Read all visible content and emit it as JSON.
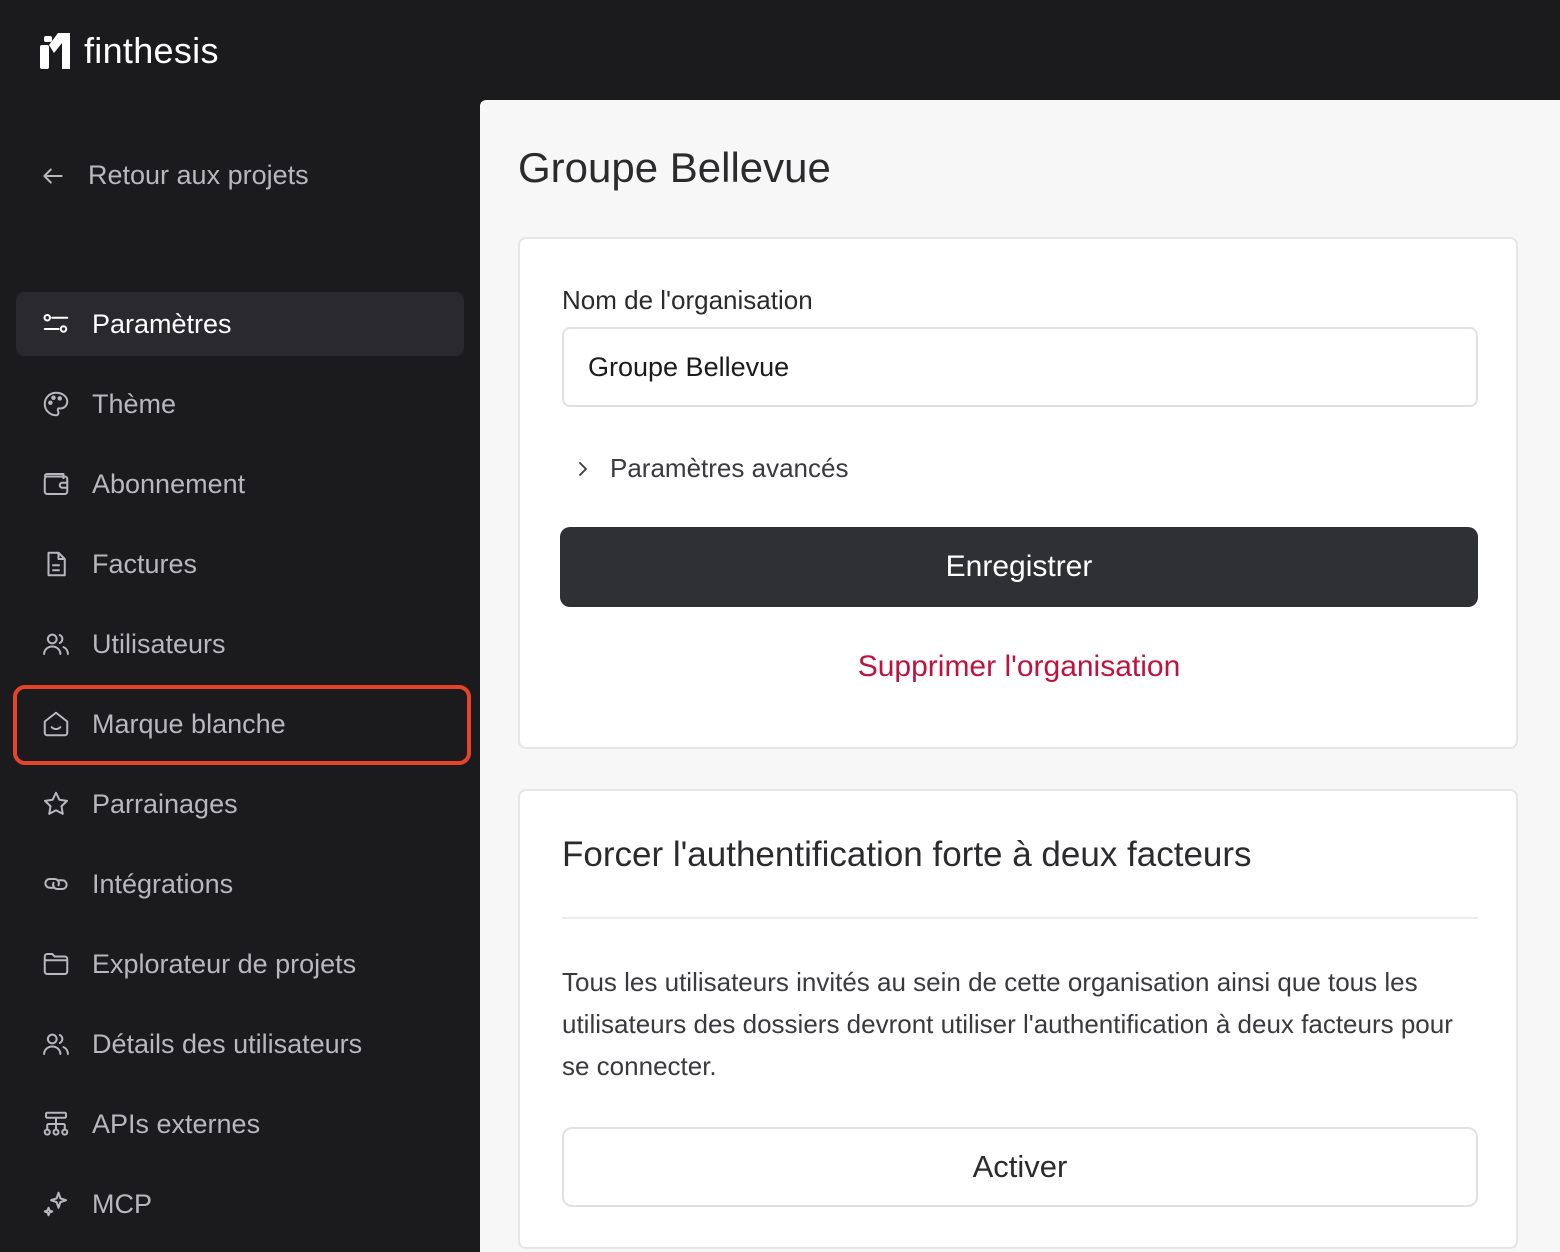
{
  "brand": {
    "name": "finthesis"
  },
  "sidebar": {
    "back_label": "Retour aux projets",
    "items": [
      {
        "label": "Paramètres",
        "icon": "settings-sliders-icon",
        "active": true
      },
      {
        "label": "Thème",
        "icon": "palette-icon"
      },
      {
        "label": "Abonnement",
        "icon": "wallet-icon"
      },
      {
        "label": "Factures",
        "icon": "document-icon"
      },
      {
        "label": "Utilisateurs",
        "icon": "users-icon"
      },
      {
        "label": "Marque blanche",
        "icon": "home-smile-icon",
        "highlighted": true
      },
      {
        "label": "Parrainages",
        "icon": "star-icon"
      },
      {
        "label": "Intégrations",
        "icon": "link-icon"
      },
      {
        "label": "Explorateur de projets",
        "icon": "folder-icon"
      },
      {
        "label": "Détails des utilisateurs",
        "icon": "users-icon"
      },
      {
        "label": "APIs externes",
        "icon": "hierarchy-icon"
      },
      {
        "label": "MCP",
        "icon": "sparkle-icon"
      }
    ],
    "highlight_color": "#e5442b"
  },
  "main": {
    "title": "Groupe Bellevue",
    "org_card": {
      "name_label": "Nom de l'organisation",
      "name_value": "Groupe Bellevue",
      "advanced_label": "Paramètres avancés",
      "save_label": "Enregistrer",
      "delete_label": "Supprimer l'organisation"
    },
    "twofa_card": {
      "title": "Forcer l'authentification forte à deux facteurs",
      "description": "Tous les utilisateurs invités au sein de cette organisation ainsi que tous les utilisateurs des dossiers devront utiliser l'authentification à deux facteurs pour se connecter.",
      "enable_label": "Activer"
    }
  },
  "colors": {
    "sidebar_bg": "#1b1b1e",
    "danger": "#c0123f",
    "primary_button": "#2f3033"
  }
}
